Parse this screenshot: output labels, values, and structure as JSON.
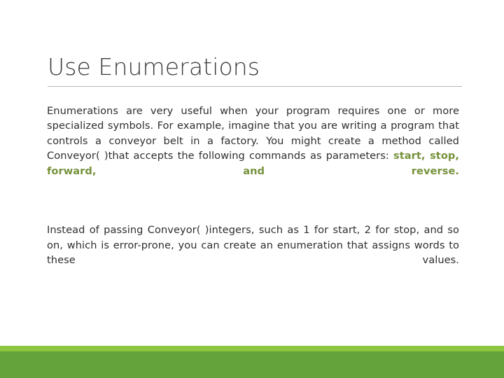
{
  "slide": {
    "title": "Use Enumerations",
    "paragraphs": [
      {
        "id": "p1",
        "lead_text": "Enumerations are very useful when your program requires one or more specialized symbols. For example, imagine that you are writing a program that controls a conveyor belt in a factory. You might create a method called Conveyor( )that accepts the following commands as parameters: ",
        "highlight_text": "start, stop, forward, and reverse."
      },
      {
        "id": "p2",
        "lead_text": " Instead of passing Conveyor( )integers, such as 1 for start, 2 for stop, and so on, which is error-prone, you can create an enumeration that assigns words to these values."
      }
    ]
  },
  "theme": {
    "title_color": "#3b3b3b",
    "body_color": "#2f2f2f",
    "rule_color": "#b8b8b8",
    "accent_green": "#76923c",
    "band_light_green": "#8dc63f",
    "band_dark_green": "#64a23c",
    "background": "#ffffff"
  }
}
